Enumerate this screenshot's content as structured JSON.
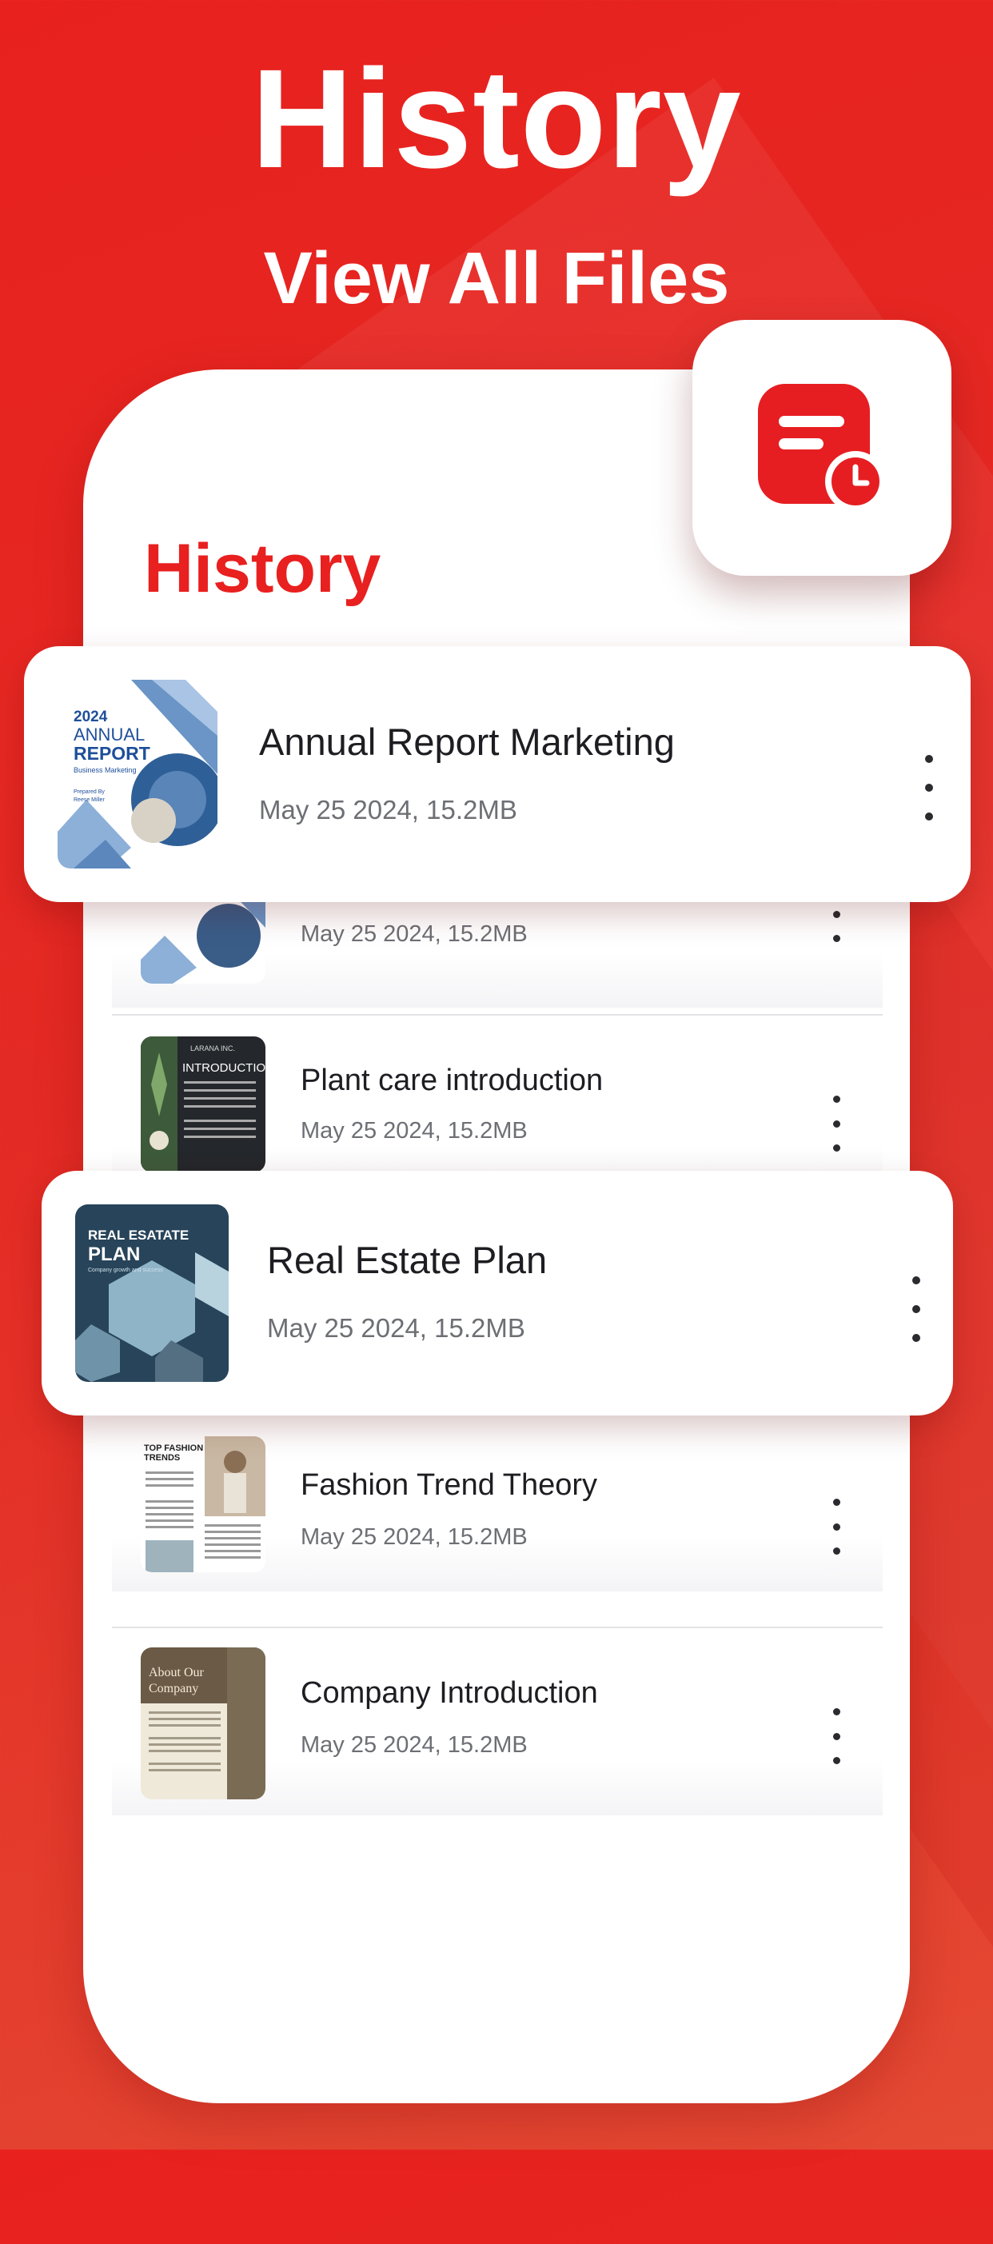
{
  "header": {
    "title": "History",
    "subtitle": "View All Files"
  },
  "screen": {
    "title": "History",
    "badge_icon": "history-document-clock-icon",
    "accent": "#e8201f"
  },
  "files": [
    {
      "name": "Annual Report Marketing",
      "meta": "May 25 2024, 15.2MB",
      "thumb": "annual-report"
    },
    {
      "name": "Plant care introduction",
      "meta": "May 25 2024, 15.2MB",
      "thumb": "plant-care"
    },
    {
      "name": "Real Estate Plan",
      "meta": "May 25 2024, 15.2MB",
      "thumb": "real-estate"
    },
    {
      "name": "Fashion Trend Theory",
      "meta": "May 25 2024, 15.2MB",
      "thumb": "fashion"
    },
    {
      "name": "Company Introduction",
      "meta": "May 25 2024, 15.2MB",
      "thumb": "company"
    }
  ],
  "thumbnails": {
    "annual_report": {
      "year": "2024",
      "line1": "ANNUAL",
      "line2": "REPORT",
      "line3": "Business Marketing",
      "prepared": "Prepared By",
      "author": "Reese Miller"
    },
    "plant_care": {
      "brand": "LARANA INC.",
      "heading": "INTRODUCTION"
    },
    "real_estate": {
      "line1": "REAL ESATATE",
      "line2": "PLAN",
      "tagline": "Company growth and success"
    },
    "fashion": {
      "heading1": "TOP FASHION",
      "heading2": "TRENDS"
    },
    "company": {
      "heading1": "About Our",
      "heading2": "Company"
    }
  }
}
